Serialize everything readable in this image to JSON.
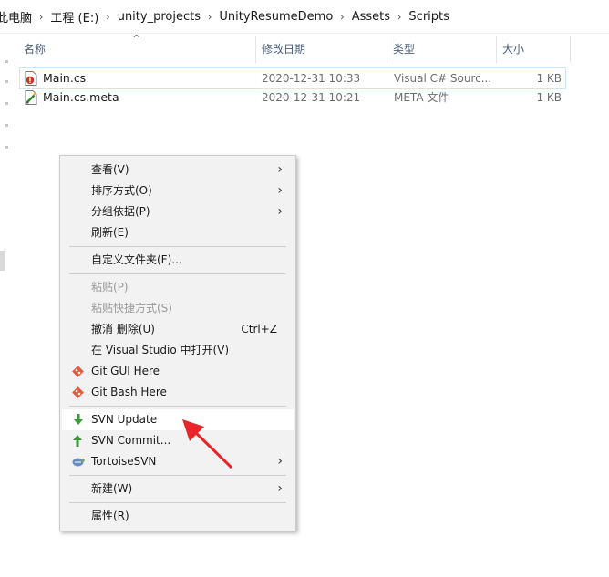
{
  "breadcrumb": {
    "items": [
      "此电脑",
      "工程 (E:)",
      "unity_projects",
      "UnityResumeDemo",
      "Assets",
      "Scripts"
    ],
    "separator": "›"
  },
  "columns": {
    "name": "名称",
    "date": "修改日期",
    "type": "类型",
    "size": "大小",
    "sort_indicator": "^"
  },
  "files": [
    {
      "name": "Main.cs",
      "date": "2020-12-31 10:33",
      "type": "Visual C# Sourc...",
      "size": "1 KB",
      "icon": "csharp-file-icon"
    },
    {
      "name": "Main.cs.meta",
      "date": "2020-12-31 10:21",
      "type": "META 文件",
      "size": "1 KB",
      "icon": "meta-file-icon"
    }
  ],
  "context_menu": {
    "view": "查看(V)",
    "sort": "排序方式(O)",
    "group": "分组依据(P)",
    "refresh": "刷新(E)",
    "customize": "自定义文件夹(F)...",
    "paste": "粘贴(P)",
    "paste_shortcut": "粘贴快捷方式(S)",
    "undo_delete": "撤消 删除(U)",
    "undo_shortcut": "Ctrl+Z",
    "open_vs": "在 Visual Studio 中打开(V)",
    "git_gui": "Git GUI Here",
    "git_bash": "Git Bash Here",
    "svn_update": "SVN Update",
    "svn_commit": "SVN Commit...",
    "tortoise": "TortoiseSVN",
    "new": "新建(W)",
    "properties": "属性(R)",
    "submenu_glyph": "›"
  },
  "colors": {
    "annotation_arrow": "#e8262a",
    "selection_border": "#cce8ff",
    "menu_background": "#f2f2f2",
    "git_icon": "#e35b3a",
    "svn_green": "#3a9a3a"
  }
}
